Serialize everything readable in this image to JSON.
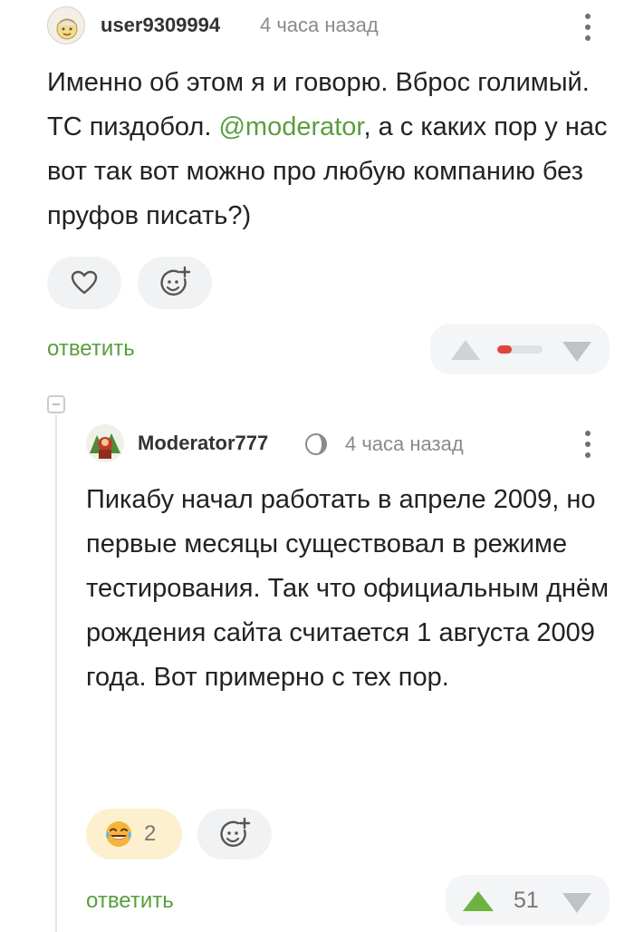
{
  "comment1": {
    "username": "user9309994",
    "time": "4 часа назад",
    "text_before": "Именно об этом я и говорю. Вброс голимый. ТС пиздобол. ",
    "mention": "@moderator",
    "text_after": ", а с каких пор у нас вот так вот можно про любую компанию без пруфов писать?)",
    "reply_label": "ответить",
    "rating_colors": {
      "up": "#cfd2d6",
      "down": "#bfc3c8",
      "bar_red": "#e0443a"
    }
  },
  "comment2": {
    "username": "Moderator777",
    "time": "4 часа назад",
    "text": "Пикабу начал работать в апреле 2009, но первые месяцы существовал в режиме тестирования. Так что официальным днём рождения сайта считается 1 августа 2009 года. Вот примерно с тех пор.",
    "reaction_count": "2",
    "reply_label": "ответить",
    "rating": "51",
    "colors": {
      "upvote": "#6db33f",
      "downvote": "#bfc3c8"
    }
  },
  "icons": {
    "like": "heart-icon",
    "add_reaction": "smiley-plus-icon",
    "laugh": "tears-of-joy-icon",
    "verified": "moderator-badge-icon"
  },
  "colors": {
    "accent_green": "#5a9e3e"
  }
}
